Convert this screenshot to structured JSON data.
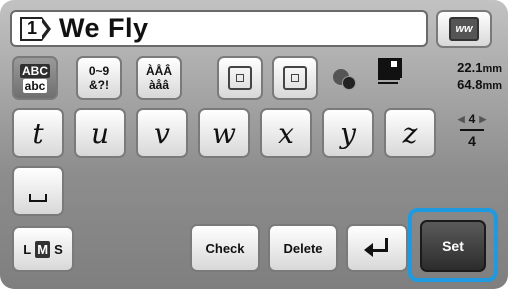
{
  "text_field": {
    "slot": "1",
    "value": "We Fly"
  },
  "preview_icon_text": "ww",
  "categories": [
    {
      "top": "ABC",
      "bottom": "abc",
      "selected": true
    },
    {
      "top": "0~9",
      "bottom": "&?!",
      "selected": false
    },
    {
      "top": "ÀÅÂ",
      "bottom": "àåâ",
      "selected": false
    }
  ],
  "size": {
    "width": "22.1",
    "height": "64.8",
    "unit": "mm"
  },
  "keys": [
    "t",
    "u",
    "v",
    "w",
    "x",
    "y",
    "z"
  ],
  "space_key": "␣",
  "page": {
    "current": "4",
    "total": "4"
  },
  "size_select": {
    "l": "L",
    "m": "M",
    "s": "S",
    "selected": "M"
  },
  "buttons": {
    "check": "Check",
    "delete": "Delete",
    "set": "Set"
  },
  "colors": {
    "highlight": "#1e9be0"
  }
}
